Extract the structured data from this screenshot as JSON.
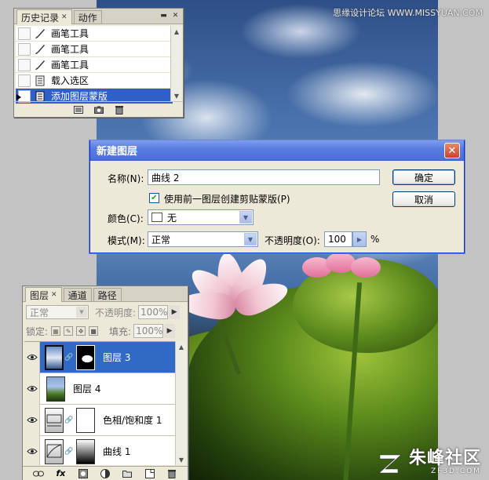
{
  "watermark_top": "思缘设计论坛 WWW.MISSYUAN.COM",
  "brand": {
    "cn": "朱峰社区",
    "en": "ZF3D.COM"
  },
  "history_panel": {
    "tabs": [
      {
        "label": "历史记录",
        "active": true
      },
      {
        "label": "动作",
        "active": false
      }
    ],
    "items": [
      {
        "label": "画笔工具",
        "icon": "brush-icon",
        "selected": false
      },
      {
        "label": "画笔工具",
        "icon": "brush-icon",
        "selected": false
      },
      {
        "label": "画笔工具",
        "icon": "brush-icon",
        "selected": false
      },
      {
        "label": "载入选区",
        "icon": "document-icon",
        "selected": false
      },
      {
        "label": "添加图层蒙版",
        "icon": "document-icon",
        "selected": true
      }
    ]
  },
  "dialog": {
    "title": "新建图层",
    "name_label": "名称(N):",
    "name_value": "曲线 2",
    "clip_checkbox_label": "使用前一图层创建剪贴蒙版(P)",
    "clip_checked": true,
    "color_label": "颜色(C):",
    "color_value": "无",
    "mode_label": "模式(M):",
    "mode_value": "正常",
    "opacity_label": "不透明度(O):",
    "opacity_value": "100",
    "opacity_unit": "%",
    "ok_label": "确定",
    "cancel_label": "取消"
  },
  "layers_panel": {
    "tabs": [
      {
        "label": "图层",
        "active": true
      },
      {
        "label": "通道",
        "active": false
      },
      {
        "label": "路径",
        "active": false
      }
    ],
    "blend_mode": "正常",
    "opacity_label": "不透明度:",
    "opacity_value": "100%",
    "lock_label": "锁定:",
    "fill_label": "填充:",
    "fill_value": "100%",
    "layers": [
      {
        "name": "图层 3",
        "selected": true,
        "visible": true
      },
      {
        "name": "图层 4",
        "selected": false,
        "visible": true
      },
      {
        "name": "色相/饱和度 1",
        "selected": false,
        "visible": true
      },
      {
        "name": "曲线 1",
        "selected": false,
        "visible": true
      }
    ]
  },
  "colors": {
    "selection_blue": "#316ac5",
    "titlebar_blue": "#4a6fd8",
    "panel_bg": "#ece9d8"
  }
}
